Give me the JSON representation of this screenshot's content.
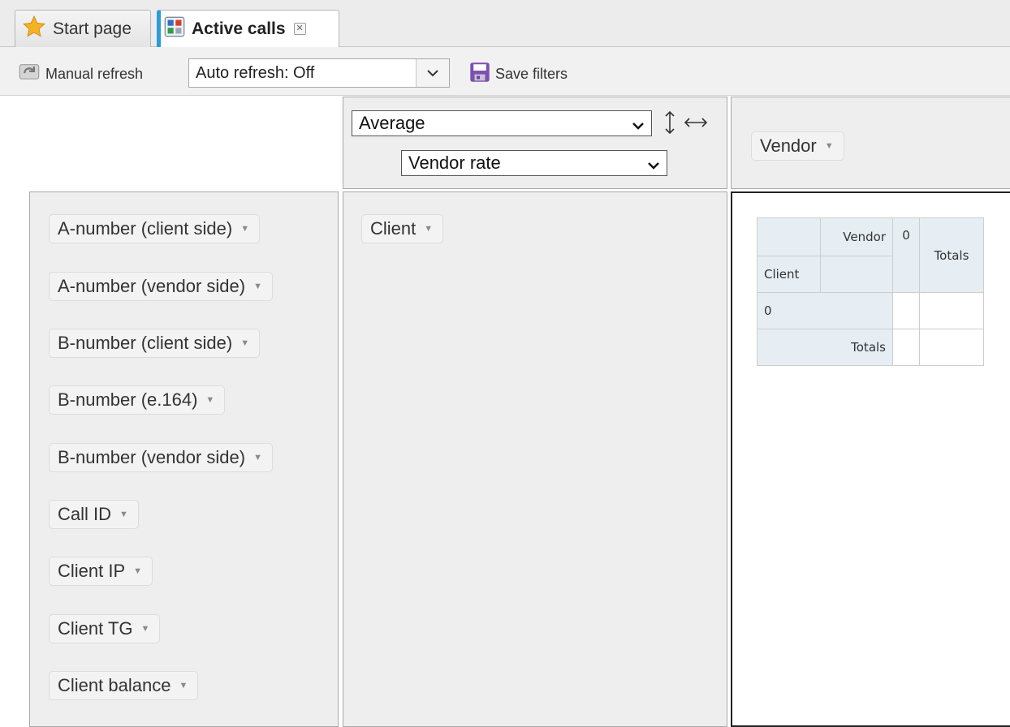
{
  "tabs": [
    {
      "label": "Start page",
      "icon": "star-icon"
    },
    {
      "label": "Active calls",
      "icon": "calls-grid-icon",
      "active": true
    }
  ],
  "toolbar": {
    "manual_refresh": "Manual refresh",
    "auto_refresh_value": "Auto refresh: Off",
    "save_filters": "Save filters"
  },
  "pivot": {
    "aggregator": "Average",
    "aggregator_attribute": "Vendor rate",
    "column_fields": [
      "Vendor"
    ],
    "row_fields": [
      "Client"
    ],
    "unused_fields": [
      "A-number (client side)",
      "A-number (vendor side)",
      "B-number (client side)",
      "B-number (e.164)",
      "B-number (vendor side)",
      "Call ID",
      "Client IP",
      "Client TG",
      "Client balance"
    ]
  },
  "table": {
    "col_header": "Vendor",
    "row_header": "Client",
    "col_value": "0",
    "row_value": "0",
    "totals_col": "Totals",
    "totals_row": "Totals"
  },
  "colors": {
    "accent": "#2e9bd6",
    "panel": "#eeeeee",
    "header_cell": "#e6eef3"
  }
}
